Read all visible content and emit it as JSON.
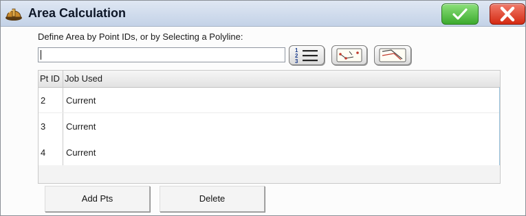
{
  "window": {
    "title": "Area Calculation",
    "ok_icon": "checkmark-icon",
    "close_icon": "close-icon",
    "app_icon": "hard-hat-icon"
  },
  "form": {
    "prompt": "Define Area by Point IDs, or by Selecting a Polyline:",
    "point_ids_value": "",
    "tools": [
      "numbered-list-icon",
      "select-points-icon",
      "select-polyline-icon"
    ]
  },
  "table": {
    "columns": [
      "Pt ID",
      "Job Used"
    ],
    "rows": [
      {
        "pt_id": "2",
        "job": "Current"
      },
      {
        "pt_id": "3",
        "job": "Current"
      },
      {
        "pt_id": "4",
        "job": "Current"
      }
    ]
  },
  "buttons": {
    "add_pts": "Add Pts",
    "delete": "Delete"
  },
  "colors": {
    "ok_green": "#3caa2e",
    "close_red": "#d42a12",
    "title_bar": "#c3d2e7"
  }
}
